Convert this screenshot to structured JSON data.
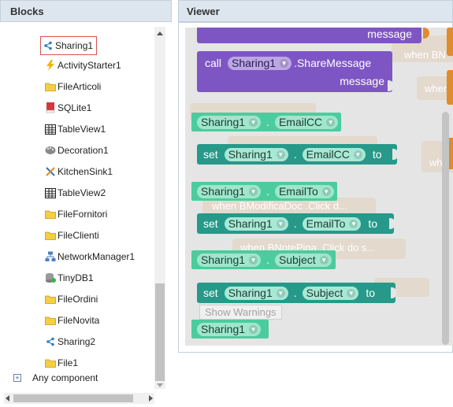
{
  "blocks_panel": {
    "title": "Blocks",
    "items": [
      {
        "label": "Sharing1",
        "icon": "share-icon",
        "selected": true
      },
      {
        "label": "ActivityStarter1",
        "icon": "lightning-icon"
      },
      {
        "label": "FileArticoli",
        "icon": "folder-icon"
      },
      {
        "label": "SQLite1",
        "icon": "sqlite-icon"
      },
      {
        "label": "TableView1",
        "icon": "table-icon"
      },
      {
        "label": "Decoration1",
        "icon": "palette-icon"
      },
      {
        "label": "KitchenSink1",
        "icon": "tools-icon"
      },
      {
        "label": "TableView2",
        "icon": "table-icon"
      },
      {
        "label": "FileFornitori",
        "icon": "folder-icon"
      },
      {
        "label": "FileClienti",
        "icon": "folder-icon"
      },
      {
        "label": "NetworkManager1",
        "icon": "network-icon"
      },
      {
        "label": "TinyDB1",
        "icon": "database-icon"
      },
      {
        "label": "FileOrdini",
        "icon": "folder-icon"
      },
      {
        "label": "FileNovita",
        "icon": "folder-icon"
      },
      {
        "label": "Sharing2",
        "icon": "share-icon"
      },
      {
        "label": "File1",
        "icon": "folder-icon"
      }
    ],
    "any_component": "Any component"
  },
  "viewer": {
    "title": "Viewer",
    "ghosts": {
      "when_bn": "when  BN",
      "when_b": "when",
      "when_bmodifica": "when  BModificaDoc .Click d...",
      "when_bnotepiga": "when  BNotePiga .Click do s...",
      "when_short": "whe",
      "show_warnings": "Show Warnings"
    },
    "blocks": {
      "top_message": "message",
      "call_keyword": "call",
      "call_component": "Sharing1",
      "call_method": ".ShareMessage",
      "call_message": "message",
      "getter1_component": "Sharing1",
      "getter1_property": "EmailCC",
      "setter1_set": "set",
      "setter1_component": "Sharing1",
      "setter1_property": "EmailCC",
      "setter1_to": "to",
      "getter2_component": "Sharing1",
      "getter2_property": "EmailTo",
      "setter2_set": "set",
      "setter2_component": "Sharing1",
      "setter2_property": "EmailTo",
      "setter2_to": "to",
      "getter3_component": "Sharing1",
      "getter3_property": "Subject",
      "setter3_set": "set",
      "setter3_component": "Sharing1",
      "setter3_property": "Subject",
      "setter3_to": "to",
      "getter4_component": "Sharing1",
      "dot": "."
    },
    "colors": {
      "setter": "#26998a",
      "getter": "#4ccc9e",
      "call": "#7e56c4"
    }
  }
}
